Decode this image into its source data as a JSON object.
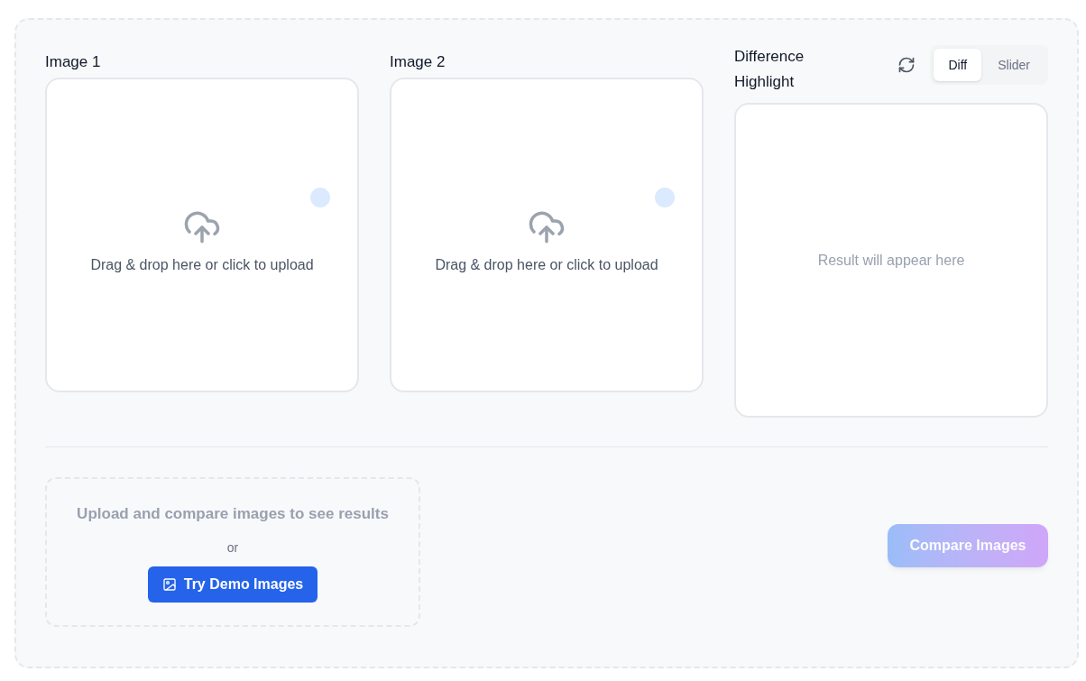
{
  "uploads": [
    {
      "label": "Image 1",
      "prompt": "Drag & drop here or click to upload"
    },
    {
      "label": "Image 2",
      "prompt": "Drag & drop here or click to upload"
    }
  ],
  "result": {
    "title": "Difference Highlight",
    "modes": [
      {
        "label": "Diff",
        "selected": true
      },
      {
        "label": "Slider",
        "selected": false
      }
    ],
    "empty_message": "Result will appear here"
  },
  "empty_state": {
    "message": "Upload and compare images to see results",
    "separator": "or",
    "demo_button": "Try Demo Images"
  },
  "compare_button": {
    "label": "Compare Images",
    "disabled": true
  }
}
